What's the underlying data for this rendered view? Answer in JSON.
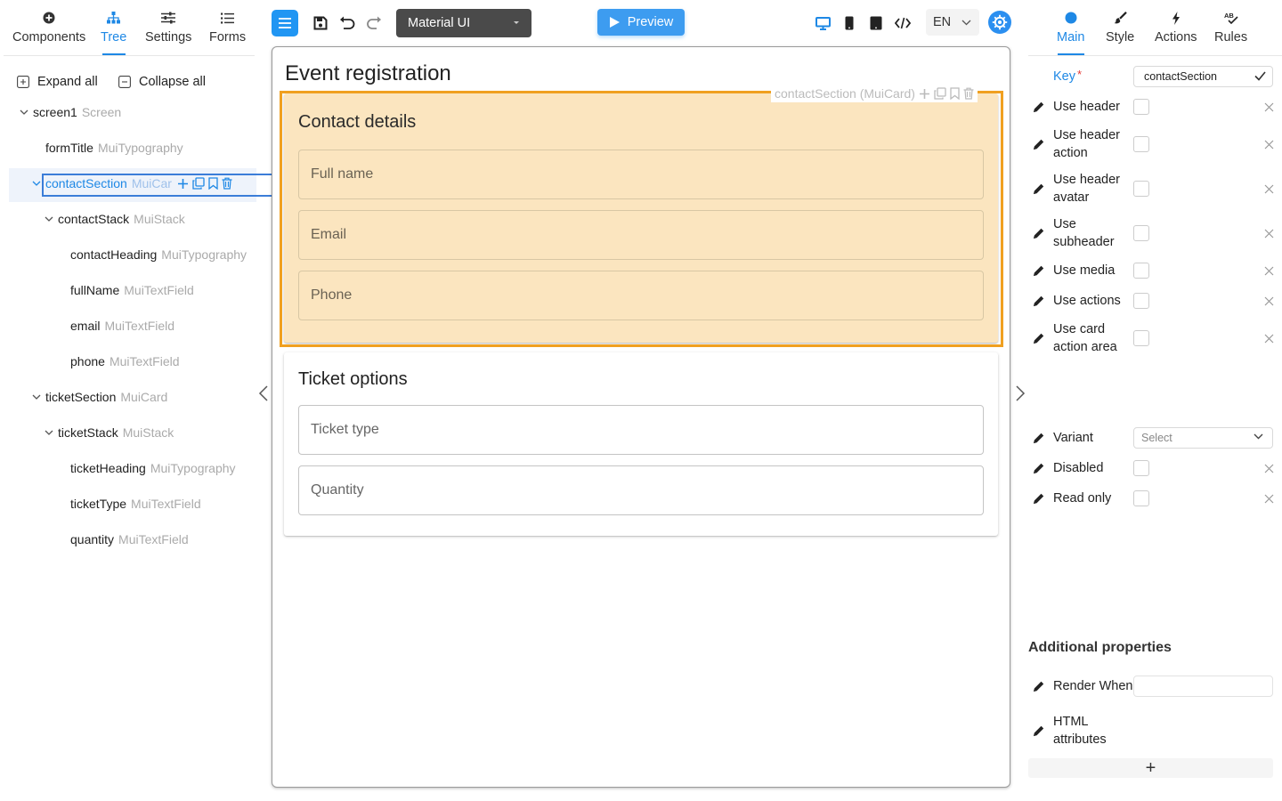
{
  "left_panel": {
    "tabs": [
      {
        "label": "Components",
        "icon": "plus-circle-icon"
      },
      {
        "label": "Tree",
        "icon": "sitemap-icon",
        "active": true
      },
      {
        "label": "Settings",
        "icon": "sliders-icon"
      },
      {
        "label": "Forms",
        "icon": "list-icon"
      }
    ],
    "expand_all": "Expand all",
    "collapse_all": "Collapse all",
    "tree": [
      {
        "name": "screen1",
        "type": "Screen",
        "depth": 0,
        "expanded": true
      },
      {
        "name": "formTitle",
        "type": "MuiTypography",
        "depth": 1
      },
      {
        "name": "contactSection",
        "type": "MuiCar",
        "depth": 1,
        "expanded": true,
        "selected": true
      },
      {
        "name": "contactStack",
        "type": "MuiStack",
        "depth": 2,
        "expanded": true
      },
      {
        "name": "contactHeading",
        "type": "MuiTypography",
        "depth": 3
      },
      {
        "name": "fullName",
        "type": "MuiTextField",
        "depth": 3
      },
      {
        "name": "email",
        "type": "MuiTextField",
        "depth": 3
      },
      {
        "name": "phone",
        "type": "MuiTextField",
        "depth": 3
      },
      {
        "name": "ticketSection",
        "type": "MuiCard",
        "depth": 1,
        "expanded": true
      },
      {
        "name": "ticketStack",
        "type": "MuiStack",
        "depth": 2,
        "expanded": true
      },
      {
        "name": "ticketHeading",
        "type": "MuiTypography",
        "depth": 3
      },
      {
        "name": "ticketType",
        "type": "MuiTextField",
        "depth": 3
      },
      {
        "name": "quantity",
        "type": "MuiTextField",
        "depth": 3
      }
    ]
  },
  "toolbar": {
    "library": "Material UI",
    "preview": "Preview",
    "language": "EN",
    "accent": "#2196f3"
  },
  "canvas": {
    "form_title": "Event registration",
    "selection_label": "contactSection (MuiCard)",
    "contact_card": {
      "title": "Contact details",
      "fields": [
        "Full name",
        "Email",
        "Phone"
      ],
      "highlight": "#fbe5bf",
      "frame": "#f0a020"
    },
    "ticket_card": {
      "title": "Ticket options",
      "fields": [
        "Ticket type",
        "Quantity"
      ]
    }
  },
  "right_panel": {
    "tabs": [
      {
        "label": "Main",
        "icon": "circle-icon",
        "active": true
      },
      {
        "label": "Style",
        "icon": "brush-icon"
      },
      {
        "label": "Actions",
        "icon": "bolt-icon"
      },
      {
        "label": "Rules",
        "icon": "spellcheck-icon"
      }
    ],
    "key_label": "Key",
    "key_required_mark": "*",
    "key_value": "contactSection",
    "props": [
      {
        "label": "Use header",
        "checked": false
      },
      {
        "label": "Use header action",
        "checked": false
      },
      {
        "label": "Use header avatar",
        "checked": false
      },
      {
        "label": "Use subheader",
        "checked": false
      },
      {
        "label": "Use media",
        "checked": false
      },
      {
        "label": "Use actions",
        "checked": false
      },
      {
        "label": "Use card action area",
        "checked": false
      }
    ],
    "variant_label": "Variant",
    "variant_placeholder": "Select",
    "disabled_label": "Disabled",
    "readonly_label": "Read only",
    "additional_title": "Additional properties",
    "render_when_label": "Render When",
    "html_attributes_label": "HTML attributes",
    "add_button": "+"
  }
}
